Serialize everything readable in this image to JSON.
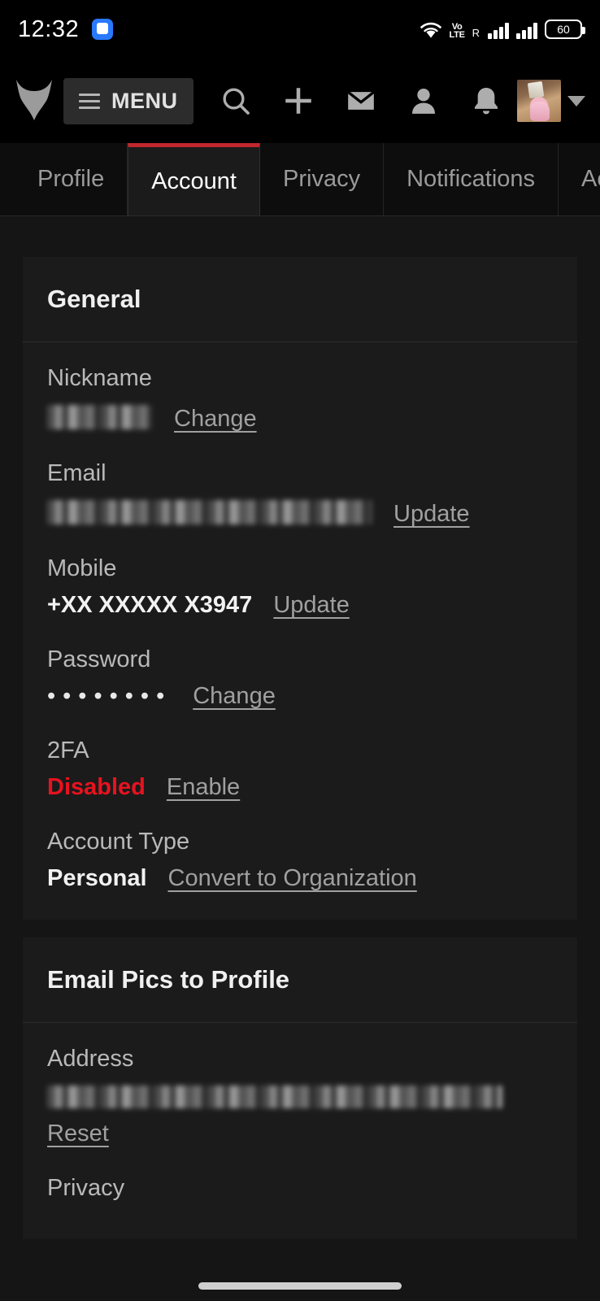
{
  "statusbar": {
    "time": "12:32",
    "app_icon": "message-icon",
    "wifi_icon": "wifi-icon",
    "network_label": "Vo\nLTE",
    "network_label_line1": "Vo",
    "network_label_line2": "LTE",
    "roaming": "R",
    "battery_percent": "60"
  },
  "navbar": {
    "logo": "furaffinity-logo",
    "menu_label": "MENU",
    "icons": [
      {
        "name": "search-icon",
        "label": "Search"
      },
      {
        "name": "plus-icon",
        "label": "Submit"
      },
      {
        "name": "mail-icon",
        "label": "Messages"
      },
      {
        "name": "user-icon",
        "label": "Profile"
      },
      {
        "name": "bell-icon",
        "label": "Notifications"
      }
    ],
    "avatar": "user-avatar",
    "caret": "chevron-down-icon"
  },
  "tabs": [
    {
      "label": "Profile",
      "active": false
    },
    {
      "label": "Account",
      "active": true
    },
    {
      "label": "Privacy",
      "active": false
    },
    {
      "label": "Notifications",
      "active": false
    },
    {
      "label": "Activi",
      "active": false
    }
  ],
  "cards": [
    {
      "title": "General",
      "fields": [
        {
          "label": "Nickname",
          "value": "",
          "redacted": true,
          "redacted_width": "nick",
          "link": "Change",
          "style": "normal"
        },
        {
          "label": "Email",
          "value": "",
          "redacted": true,
          "redacted_width": "email",
          "link": "Update",
          "style": "normal"
        },
        {
          "label": "Mobile",
          "value": "+XX XXXXX X3947",
          "redacted": false,
          "link": "Update",
          "style": "bold"
        },
        {
          "label": "Password",
          "value": "••••••••",
          "redacted": false,
          "link": "Change",
          "style": "dots"
        },
        {
          "label": "2FA",
          "value": "Disabled",
          "redacted": false,
          "link": "Enable",
          "style": "danger"
        },
        {
          "label": "Account Type",
          "value": "Personal",
          "redacted": false,
          "link": "Convert to Organization",
          "style": "bold"
        }
      ]
    },
    {
      "title": "Email Pics to Profile",
      "fields": [
        {
          "label": "Address",
          "value": "",
          "redacted": true,
          "redacted_width": "addr",
          "link": "Reset",
          "style": "normal"
        },
        {
          "label": "Privacy",
          "value": "",
          "redacted": false,
          "link": "",
          "style": "normal"
        }
      ]
    }
  ],
  "colors": {
    "accent_red": "#c1272d",
    "danger_red": "#e8121f",
    "page_bg": "#151515",
    "card_bg": "#1b1b1b",
    "nav_bg": "#000000"
  }
}
